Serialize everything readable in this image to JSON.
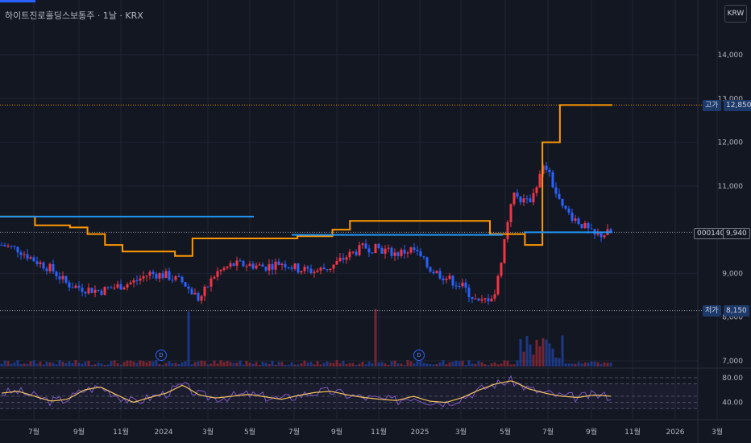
{
  "header": {
    "title": "하이트진로홀딩스보통주 · 1날 · KRX",
    "currency_button": "KRW"
  },
  "price_axis": {
    "labels": [
      "14,000",
      "13,000",
      "12,000",
      "11,000",
      "9,000",
      "8,000",
      "7,000"
    ],
    "values": [
      14000,
      13000,
      12000,
      11000,
      9000,
      8000,
      7000
    ]
  },
  "rsi_axis": {
    "labels": [
      "80.00",
      "40.00"
    ],
    "values": [
      80,
      40
    ]
  },
  "time_axis": {
    "labels": [
      "7월",
      "9월",
      "11월",
      "2024",
      "3월",
      "5월",
      "7월",
      "9월",
      "11월",
      "2025",
      "3월",
      "5월",
      "7월",
      "9월",
      "11월",
      "2026",
      "3월"
    ]
  },
  "markers": {
    "high_label": "고가",
    "high_value": "12,850",
    "low_label": "저가",
    "low_value": "8,150",
    "symbol": "000140",
    "last_value": "9,940"
  },
  "dividend_markers": [
    "D",
    "D"
  ],
  "colors": {
    "background": "#131722",
    "up": "#f23645",
    "down": "#2962ff",
    "orange_line": "#ff9800",
    "blue_line": "#2196f3",
    "rsi_line": "#7e57c2",
    "rsi_ma": "#f5c45e",
    "grid": "#1f2433"
  },
  "chart_data": {
    "type": "line",
    "x_ticks": [
      "7월",
      "9월",
      "11월",
      "2024",
      "3월",
      "5월",
      "7월",
      "9월",
      "11월",
      "2025",
      "3월",
      "5월",
      "7월",
      "9월",
      "11월",
      "2026",
      "3월"
    ],
    "price_close": [
      9650,
      9550,
      9300,
      9100,
      8750,
      8650,
      8600,
      8700,
      8800,
      9000,
      8950,
      8800,
      8400,
      9000,
      9200,
      9200,
      9150,
      9250,
      9100,
      9050,
      9150,
      9400,
      9600,
      9550,
      9450,
      9550,
      9100,
      8900,
      8700,
      8300,
      8550,
      10800,
      10600,
      11500,
      10500,
      10200,
      9850,
      9940
    ],
    "orange_resistance": [
      10300,
      10300,
      10100,
      10100,
      10050,
      9900,
      9650,
      9500,
      9500,
      9500,
      9400,
      9800,
      9800,
      9800,
      9800,
      9800,
      9800,
      9850,
      9850,
      10000,
      10200,
      10200,
      10200,
      10200,
      10200,
      10200,
      10200,
      10200,
      9900,
      9900,
      9650,
      12000,
      12850,
      12850,
      12850,
      12850
    ],
    "blue_levels": [
      {
        "from": "7월",
        "to": "5월",
        "value": 10300
      },
      {
        "from": "7월",
        "to": "5월",
        "value": 9760
      },
      {
        "from": "7월",
        "to": "9월",
        "value": 9880
      }
    ],
    "high": 12850,
    "low": 8150,
    "last": 9940,
    "rsi": [
      55,
      58,
      50,
      42,
      45,
      60,
      65,
      52,
      40,
      48,
      55,
      68,
      52,
      47,
      50,
      53,
      49,
      45,
      51,
      56,
      58,
      52,
      48,
      45,
      43,
      50,
      42,
      40,
      48,
      60,
      70,
      75,
      62,
      55,
      50,
      48,
      52,
      50
    ],
    "rsi_ylim": [
      20,
      85
    ]
  }
}
